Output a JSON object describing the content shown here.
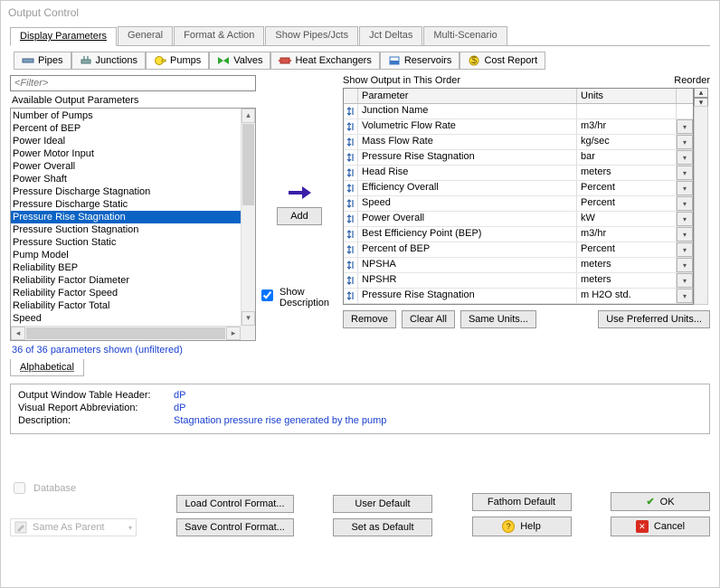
{
  "window": {
    "title": "Output Control"
  },
  "tabs": {
    "items": [
      {
        "label": "Display Parameters",
        "active": true
      },
      {
        "label": "General"
      },
      {
        "label": "Format & Action"
      },
      {
        "label": "Show Pipes/Jcts"
      },
      {
        "label": "Jct Deltas"
      },
      {
        "label": "Multi-Scenario"
      }
    ]
  },
  "subtabs": {
    "items": [
      {
        "label": "Pipes",
        "icon": "pipes-icon"
      },
      {
        "label": "Junctions",
        "icon": "junctions-icon"
      },
      {
        "label": "Pumps",
        "icon": "pumps-icon",
        "active": true
      },
      {
        "label": "Valves",
        "icon": "valves-icon"
      },
      {
        "label": "Heat Exchangers",
        "icon": "heat-exchangers-icon"
      },
      {
        "label": "Reservoirs",
        "icon": "reservoirs-icon"
      },
      {
        "label": "Cost Report",
        "icon": "cost-report-icon"
      }
    ]
  },
  "filter": {
    "placeholder": "<Filter>"
  },
  "available": {
    "label": "Available Output Parameters",
    "items": [
      "Number of Pumps",
      "Percent of BEP",
      "Power Ideal",
      "Power Motor Input",
      "Power Overall",
      "Power Shaft",
      "Pressure Discharge Stagnation",
      "Pressure Discharge Static",
      "Pressure Rise Stagnation",
      "Pressure Suction Stagnation",
      "Pressure Suction Static",
      "Pump Model",
      "Reliability BEP",
      "Reliability Factor Diameter",
      "Reliability Factor Speed",
      "Reliability Factor Total",
      "Speed"
    ],
    "selected_index": 8,
    "shown_text": "36 of 36 parameters shown (unfiltered)"
  },
  "sort_tab": {
    "label": "Alphabetical"
  },
  "add_button": {
    "label": "Add"
  },
  "show_desc": {
    "checked": true,
    "label": "Show Description"
  },
  "output_order": {
    "label": "Show Output in This Order",
    "reorder_label": "Reorder",
    "columns": {
      "param": "Parameter",
      "units": "Units"
    },
    "rows": [
      {
        "param": "Junction Name",
        "units": "",
        "dd": false
      },
      {
        "param": "Volumetric Flow Rate",
        "units": "m3/hr",
        "dd": true
      },
      {
        "param": "Mass Flow Rate",
        "units": "kg/sec",
        "dd": true
      },
      {
        "param": "Pressure Rise Stagnation",
        "units": "bar",
        "dd": true
      },
      {
        "param": "Head Rise",
        "units": "meters",
        "dd": true
      },
      {
        "param": "Efficiency Overall",
        "units": "Percent",
        "dd": true
      },
      {
        "param": "Speed",
        "units": "Percent",
        "dd": true
      },
      {
        "param": "Power Overall",
        "units": "kW",
        "dd": true
      },
      {
        "param": "Best Efficiency Point (BEP)",
        "units": "m3/hr",
        "dd": true
      },
      {
        "param": "Percent of BEP",
        "units": "Percent",
        "dd": true
      },
      {
        "param": "NPSHA",
        "units": "meters",
        "dd": true
      },
      {
        "param": "NPSHR",
        "units": "meters",
        "dd": true
      },
      {
        "param": "Pressure Rise Stagnation",
        "units": "m H2O std.",
        "dd": true
      }
    ]
  },
  "right_buttons": {
    "remove": "Remove",
    "clear": "Clear All",
    "same": "Same Units...",
    "preferred": "Use Preferred Units..."
  },
  "description": {
    "header_lbl": "Output Window Table Header:",
    "header_val": "dP",
    "abbrev_lbl": "Visual Report Abbreviation:",
    "abbrev_val": "dP",
    "desc_lbl": "Description:",
    "desc_val": "Stagnation pressure rise generated by the pump"
  },
  "bottom": {
    "database": "Database",
    "same_parent": "Same As Parent",
    "load_fmt": "Load Control Format...",
    "save_fmt": "Save Control Format...",
    "user_default": "User Default",
    "set_default": "Set as Default",
    "fathom_default": "Fathom Default",
    "help": "Help",
    "ok": "OK",
    "cancel": "Cancel"
  }
}
